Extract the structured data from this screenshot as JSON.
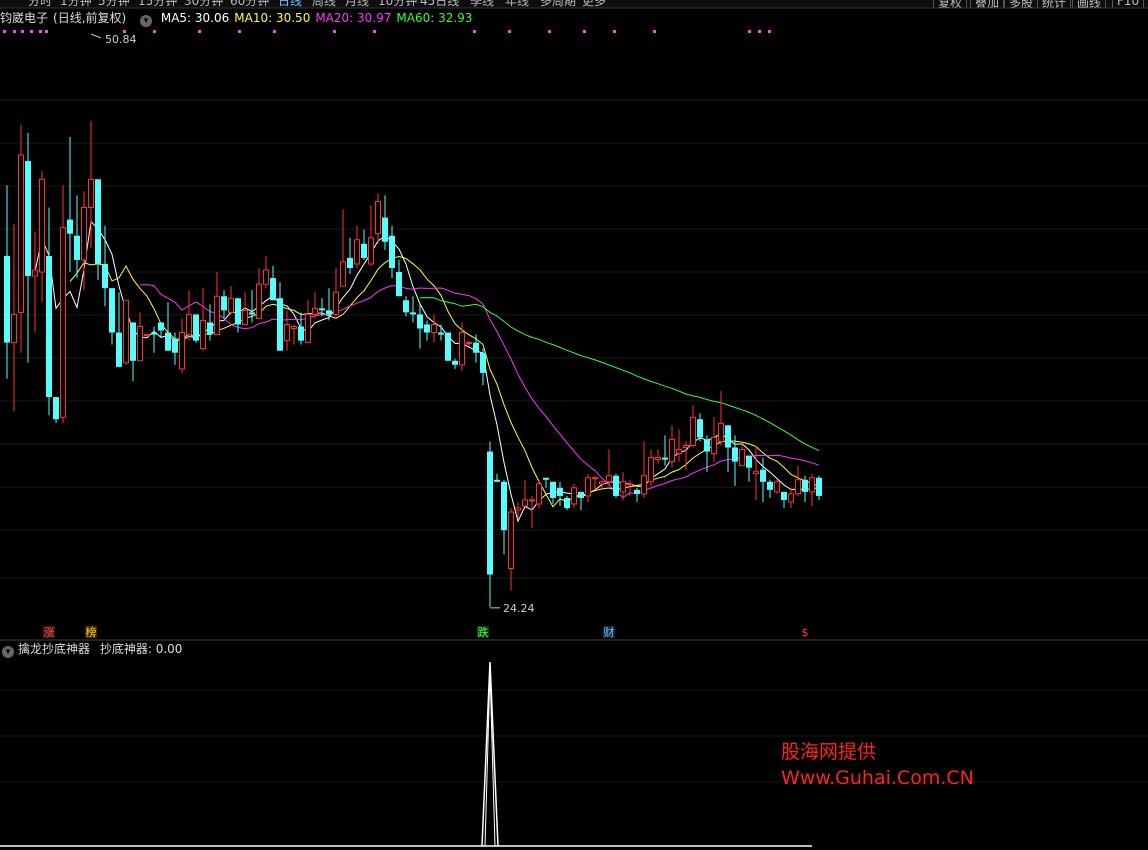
{
  "toolbar": {
    "periods": [
      "分时",
      "1分钟",
      "5分钟",
      "15分钟",
      "30分钟",
      "60分钟",
      "日线",
      "周线",
      "月线",
      "10分钟",
      "45日线",
      "季线",
      "年线",
      "多周期",
      "更多"
    ],
    "active_period": "日线",
    "right_buttons": [
      "复权",
      "叠加",
      "多股",
      "统计",
      "画线",
      "F10"
    ]
  },
  "stock": {
    "name": "钧崴电子",
    "mode": "(日线,前复权)"
  },
  "ma_legend": [
    {
      "label": "MA5: 30.06",
      "color": "#ffffff"
    },
    {
      "label": "MA10: 30.50",
      "color": "#ffff33"
    },
    {
      "label": "MA20: 30.97",
      "color": "#ff33ff"
    },
    {
      "label": "MA60: 32.93",
      "color": "#33ff33"
    }
  ],
  "price_labels": {
    "high": "50.84",
    "low": "24.24"
  },
  "event_markers": [
    {
      "text": "涨",
      "color": "#ff4444",
      "bg": "#3a1a1a",
      "index": 6
    },
    {
      "text": "榜",
      "color": "#ffd000",
      "bg": "#3a2a00",
      "index": 12
    },
    {
      "text": "跌",
      "color": "#44ff44",
      "bg": "#113311",
      "index": 68
    },
    {
      "text": "财",
      "color": "#66ccff",
      "bg": "#112233",
      "index": 86
    },
    {
      "text": "$",
      "color": "#ff4444",
      "bg": "#000000",
      "index": 114
    }
  ],
  "indicator": {
    "title": "擒龙抄底神器",
    "line_label": "抄底神器: 0.00"
  },
  "watermark": {
    "line1": "股海网提供",
    "line2": "Www.Guhai.Com.CN"
  },
  "colors": {
    "up": "#ff3232",
    "down": "#54ffff",
    "ma5": "#ffffff",
    "ma10": "#ffff33",
    "ma20": "#ff33ff",
    "ma60": "#33ff33"
  },
  "chart_data": {
    "type": "candlestick",
    "ylim": [
      22.5,
      52.0
    ],
    "candles": [
      [
        40.8,
        36.5,
        44.3,
        34.7
      ],
      [
        36.5,
        37.9,
        42.4,
        33.1
      ],
      [
        38.0,
        45.8,
        47.3,
        36.0
      ],
      [
        45.5,
        39.8,
        46.9,
        35.5
      ],
      [
        39.8,
        40.1,
        42.0,
        37.0
      ],
      [
        40.0,
        44.6,
        45.0,
        38.5
      ],
      [
        40.8,
        33.8,
        43.2,
        32.9
      ],
      [
        33.8,
        32.7,
        33.8,
        32.5
      ],
      [
        32.8,
        42.2,
        44.3,
        32.5
      ],
      [
        42.6,
        41.9,
        46.7,
        40.0
      ],
      [
        41.8,
        40.6,
        43.8,
        39.7
      ],
      [
        40.6,
        43.2,
        44.0,
        39.1
      ],
      [
        43.2,
        44.6,
        47.5,
        41.2
      ],
      [
        44.6,
        40.4,
        44.6,
        39.6
      ],
      [
        40.4,
        39.2,
        42.3,
        38.3
      ],
      [
        39.2,
        37.0,
        39.2,
        36.4
      ],
      [
        37.0,
        35.3,
        39.0,
        35.3
      ],
      [
        35.5,
        38.6,
        38.6,
        35.4
      ],
      [
        37.5,
        35.6,
        37.5,
        34.6
      ],
      [
        35.6,
        37.3,
        38.0,
        36.6
      ],
      [
        36.9,
        36.9,
        36.9,
        36.9
      ],
      [
        37.0,
        36.9,
        37.3,
        36.0
      ],
      [
        37.5,
        37.1,
        37.5,
        36.8
      ],
      [
        37.0,
        36.1,
        38.5,
        36.1
      ],
      [
        36.7,
        36.0,
        37.0,
        35.4
      ],
      [
        35.2,
        37.0,
        37.7,
        35.0
      ],
      [
        36.9,
        37.9,
        39.1,
        36.6
      ],
      [
        37.9,
        36.6,
        37.9,
        36.5
      ],
      [
        36.2,
        37.6,
        39.2,
        36.1
      ],
      [
        37.5,
        36.9,
        38.4,
        36.6
      ],
      [
        36.9,
        38.8,
        40.0,
        36.9
      ],
      [
        38.8,
        38.1,
        39.1,
        37.7
      ],
      [
        38.0,
        38.7,
        39.3,
        37.9
      ],
      [
        38.7,
        37.4,
        38.7,
        37.0
      ],
      [
        37.4,
        38.1,
        39.0,
        37.4
      ],
      [
        38.0,
        37.9,
        39.1,
        37.5
      ],
      [
        37.7,
        39.4,
        40.2,
        37.7
      ],
      [
        39.4,
        40.1,
        40.8,
        39.2
      ],
      [
        39.7,
        38.6,
        40.3,
        38.6
      ],
      [
        38.7,
        36.1,
        39.5,
        36.1
      ],
      [
        36.6,
        37.4,
        38.1,
        36.1
      ],
      [
        37.2,
        37.3,
        37.4,
        36.4
      ],
      [
        37.3,
        36.6,
        38.0,
        36.4
      ],
      [
        36.5,
        37.9,
        38.6,
        36.6
      ],
      [
        37.9,
        38.2,
        39.0,
        37.7
      ],
      [
        38.2,
        38.1,
        38.7,
        37.8
      ],
      [
        38.1,
        37.9,
        39.2,
        37.6
      ],
      [
        37.9,
        39.0,
        40.2,
        37.8
      ],
      [
        39.3,
        40.5,
        43.1,
        39.3
      ],
      [
        40.7,
        40.2,
        41.7,
        39.9
      ],
      [
        40.4,
        41.6,
        42.3,
        40.2
      ],
      [
        41.4,
        40.7,
        42.1,
        40.6
      ],
      [
        40.4,
        41.7,
        43.3,
        40.3
      ],
      [
        41.9,
        43.5,
        43.9,
        41.4
      ],
      [
        42.7,
        41.5,
        43.8,
        41.1
      ],
      [
        41.8,
        40.2,
        42.3,
        39.7
      ],
      [
        40.0,
        38.8,
        40.6,
        38.8
      ],
      [
        38.6,
        38.0,
        38.8,
        37.8
      ],
      [
        38.0,
        37.9,
        38.8,
        37.5
      ],
      [
        37.9,
        37.2,
        38.4,
        36.2
      ],
      [
        37.4,
        37.0,
        37.6,
        36.6
      ],
      [
        37.0,
        37.4,
        37.9,
        36.5
      ],
      [
        37.0,
        36.9,
        37.4,
        36.6
      ],
      [
        37.0,
        35.6,
        37.0,
        35.6
      ],
      [
        35.6,
        35.4,
        35.7,
        35.2
      ],
      [
        35.4,
        37.0,
        37.5,
        35.1
      ],
      [
        36.5,
        36.5,
        36.6,
        36.3
      ],
      [
        36.5,
        36.0,
        36.9,
        35.5
      ],
      [
        36.0,
        35.0,
        36.2,
        34.4
      ],
      [
        31.1,
        25.0,
        31.6,
        23.4
      ],
      [
        29.7,
        29.6,
        30.0,
        29.6
      ],
      [
        29.6,
        27.2,
        29.7,
        26.0
      ],
      [
        25.3,
        28.1,
        28.3,
        24.2
      ],
      [
        28.2,
        28.3,
        28.6,
        27.8
      ],
      [
        28.4,
        28.7,
        29.7,
        28.5
      ],
      [
        28.7,
        28.7,
        28.9,
        27.3
      ],
      [
        28.5,
        29.5,
        29.7,
        28.3
      ],
      [
        29.8,
        29.7,
        29.8,
        29.3
      ],
      [
        29.6,
        28.8,
        29.6,
        28.5
      ],
      [
        29.3,
        28.9,
        29.6,
        28.4
      ],
      [
        28.8,
        28.3,
        28.9,
        28.2
      ],
      [
        28.5,
        29.3,
        29.5,
        28.3
      ],
      [
        29.1,
        28.8,
        29.1,
        28.2
      ],
      [
        28.9,
        29.8,
        30.0,
        28.6
      ],
      [
        29.8,
        29.8,
        29.9,
        29.2
      ],
      [
        29.5,
        29.6,
        29.7,
        29.3
      ],
      [
        29.6,
        29.9,
        31.2,
        29.4
      ],
      [
        29.9,
        28.9,
        30.0,
        28.8
      ],
      [
        29.1,
        29.6,
        30.1,
        28.7
      ],
      [
        29.5,
        29.5,
        29.7,
        28.9
      ],
      [
        29.2,
        29.0,
        29.3,
        28.6
      ],
      [
        29.0,
        29.9,
        31.6,
        28.8
      ],
      [
        29.6,
        30.8,
        31.2,
        29.4
      ],
      [
        30.7,
        30.8,
        31.2,
        30.5
      ],
      [
        30.8,
        30.7,
        31.9,
        30.4
      ],
      [
        30.6,
        31.7,
        32.4,
        30.3
      ],
      [
        31.0,
        31.2,
        32.2,
        30.6
      ],
      [
        31.3,
        31.4,
        31.6,
        30.2
      ],
      [
        31.4,
        32.8,
        33.4,
        31.3
      ],
      [
        32.7,
        31.8,
        33.0,
        31.6
      ],
      [
        31.7,
        31.1,
        31.9,
        30.1
      ],
      [
        31.0,
        31.8,
        32.8,
        30.6
      ],
      [
        31.6,
        32.5,
        34.1,
        31.4
      ],
      [
        32.4,
        31.3,
        32.4,
        30.1
      ],
      [
        31.3,
        30.6,
        31.9,
        29.4
      ],
      [
        30.4,
        31.2,
        31.4,
        30.6
      ],
      [
        30.9,
        30.3,
        30.9,
        29.6
      ],
      [
        30.0,
        30.1,
        31.4,
        28.7
      ],
      [
        30.2,
        29.6,
        30.8,
        28.6
      ],
      [
        29.6,
        29.2,
        29.7,
        28.8
      ],
      [
        29.1,
        29.6,
        29.7,
        29.0
      ],
      [
        29.1,
        28.7,
        29.1,
        28.3
      ],
      [
        28.6,
        29.0,
        29.3,
        28.3
      ],
      [
        29.0,
        29.7,
        30.4,
        28.9
      ],
      [
        29.7,
        29.1,
        29.9,
        28.6
      ],
      [
        29.1,
        29.8,
        30.0,
        28.4
      ],
      [
        29.8,
        28.9,
        29.9,
        28.7
      ]
    ],
    "indicator_values_note": "抄底神器 signal spikes to 1 only at the low of candle index 69",
    "indicator_spike_index": 69
  }
}
